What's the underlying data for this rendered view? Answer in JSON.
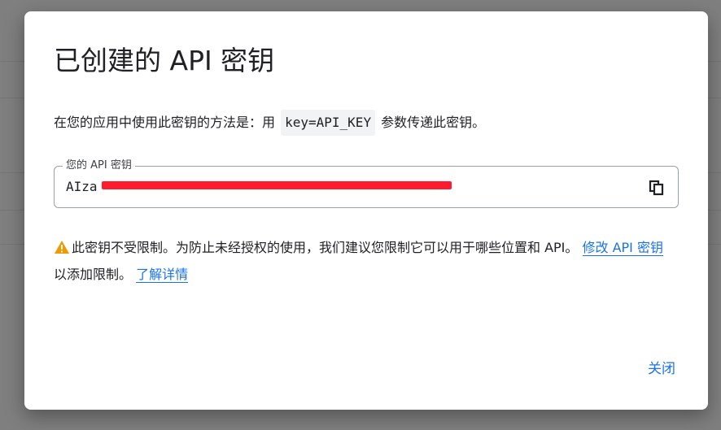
{
  "dialog": {
    "title": "已创建的 API 密钥",
    "usage_prefix": "在您的应用中使用此密钥的方法是：用",
    "usage_code": "key=API_KEY",
    "usage_suffix": "参数传递此密钥。",
    "key_field": {
      "label": "您的 API 密钥",
      "value": "AIza"
    },
    "warning": {
      "text": "此密钥不受限制。为防止未经授权的使用，我们建议您限制它可以用于哪些位置和 API。",
      "edit_link": "修改 API 密钥",
      "middle_text": "以添加限制。",
      "learn_more_link": "了解详情"
    },
    "close_label": "关闭"
  },
  "icons": {
    "copy": "copy-icon",
    "warning": "warning-icon"
  },
  "colors": {
    "accent": "#1a73e8",
    "warning": "#f29900",
    "redaction": "#ff1a2e"
  }
}
